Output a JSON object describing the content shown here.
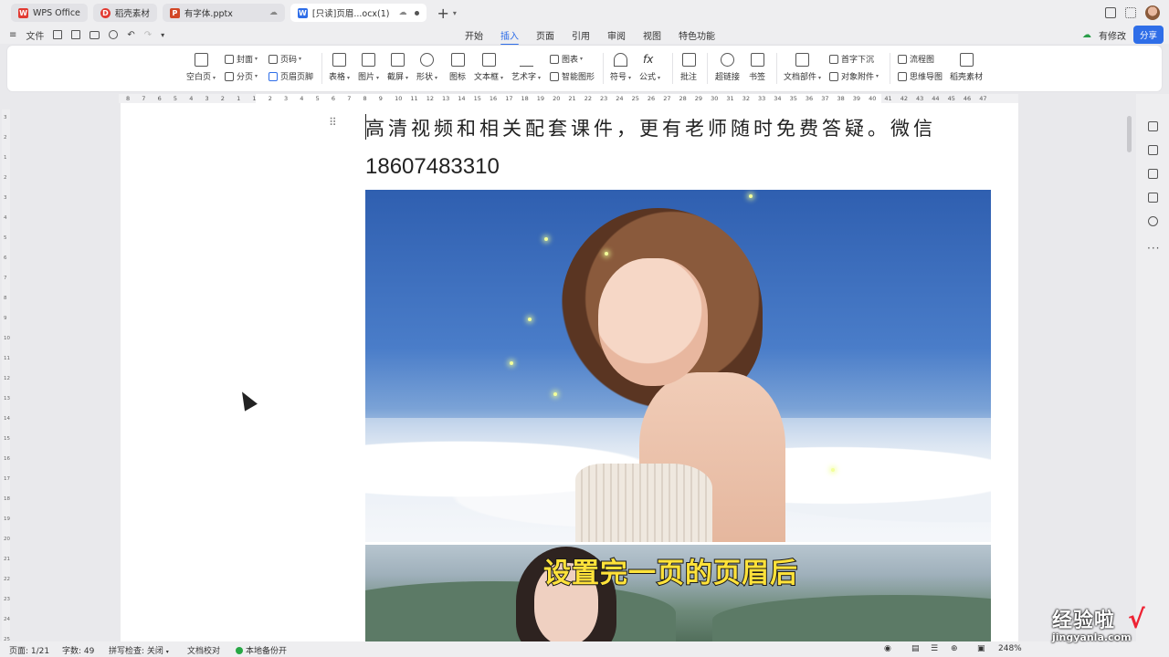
{
  "titlebar": {
    "tabs": [
      {
        "label": "WPS Office",
        "icon": "wps-logo-icon",
        "color": "#e23a32"
      },
      {
        "label": "稻壳素材",
        "icon": "docer-icon",
        "color": "#e23a32"
      },
      {
        "label": "有字体.pptx",
        "icon": "pptx-icon",
        "color": "#d24726"
      },
      {
        "label": "[只读]页眉...ocx(1)",
        "icon": "docx-icon",
        "color": "#2f6ee8"
      }
    ]
  },
  "menubar": {
    "file_label": "文件",
    "tabs": [
      "开始",
      "插入",
      "页面",
      "引用",
      "审阅",
      "视图",
      "特色功能"
    ],
    "active_tab": "插入",
    "modify_label": "有修改",
    "share_label": "分享"
  },
  "ribbon": {
    "blank_page": "空白页",
    "cover": "封面",
    "page_break": "分页",
    "page_number": "页码",
    "header_footer": "页眉页脚",
    "table": "表格",
    "picture": "图片",
    "screenshot": "截屏",
    "shape": "形状",
    "icon": "图标",
    "textbox": "文本框",
    "wordart": "艺术字",
    "chart": "图表",
    "smart_shape": "智能图形",
    "symbol": "符号",
    "formula": "公式",
    "comment": "批注",
    "hyperlink": "超链接",
    "bookmark": "书签",
    "doc_parts": "文档部件",
    "drop_cap": "首字下沉",
    "object_attach": "对象附件",
    "flowchart": "流程图",
    "mindmap": "思维导图",
    "docer_material": "稻壳素材"
  },
  "hruler": [
    "8",
    "7",
    "6",
    "5",
    "4",
    "3",
    "2",
    "1",
    "1",
    "2",
    "3",
    "4",
    "5",
    "6",
    "7",
    "8",
    "9",
    "10",
    "11",
    "12",
    "13",
    "14",
    "15",
    "16",
    "17",
    "18",
    "19",
    "20",
    "21",
    "22",
    "23",
    "24",
    "25",
    "26",
    "27",
    "28",
    "29",
    "30",
    "31",
    "32",
    "33",
    "34",
    "35",
    "36",
    "37",
    "38",
    "39",
    "40",
    "41",
    "42",
    "43",
    "44",
    "45",
    "46",
    "47"
  ],
  "vruler": [
    "3",
    "2",
    "1",
    "2",
    "3",
    "4",
    "5",
    "6",
    "7",
    "8",
    "9",
    "10",
    "11",
    "12",
    "13",
    "14",
    "15",
    "16",
    "17",
    "18",
    "19",
    "20",
    "21",
    "22",
    "23",
    "24",
    "25"
  ],
  "document": {
    "line1": "高清视频和相关配套课件，更有老师随时免费答疑。微信",
    "line2": "18607483310",
    "subtitle": "设置完一页的页眉后"
  },
  "statusbar": {
    "page": "页面: 1/21",
    "words": "字数: 49",
    "spellcheck": "拼写检查: 关闭",
    "proofread": "文档校对",
    "backup": "本地备份开",
    "zoom": "248%"
  },
  "watermark": {
    "line1": "经验啦",
    "line2": "jingyanla.com"
  }
}
